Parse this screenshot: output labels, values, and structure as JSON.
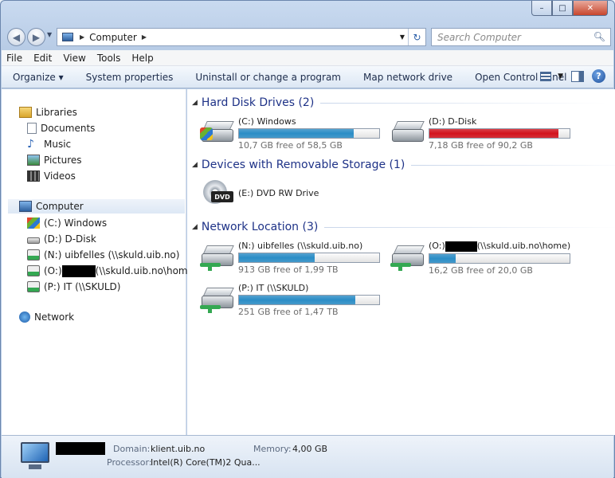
{
  "window": {
    "minimize": "–",
    "maximize": "□",
    "close": "✕"
  },
  "address": {
    "location": "Computer",
    "search_placeholder": "Search Computer"
  },
  "menu": [
    "File",
    "Edit",
    "View",
    "Tools",
    "Help"
  ],
  "toolbar": {
    "organize": "Organize ▾",
    "system_properties": "System properties",
    "uninstall": "Uninstall or change a program",
    "map_drive": "Map network drive",
    "control_panel": "Open Control Panel",
    "help": "?"
  },
  "nav": {
    "libraries": "Libraries",
    "documents": "Documents",
    "music": "Music",
    "pictures": "Pictures",
    "videos": "Videos",
    "computer": "Computer",
    "c_drive": "(C:) Windows",
    "d_drive": "(D:) D-Disk",
    "n_drive": "(N:) uibfelles (\\\\skuld.uib.no)",
    "o_drive_prefix": "(O:)",
    "o_drive_suffix": "(\\\\skuld.uib.no\\home)",
    "p_drive": "(P:) IT (\\\\SKULD)",
    "network": "Network"
  },
  "groups": {
    "hard_disk": "Hard Disk Drives (2)",
    "removable": "Devices with Removable Storage (1)",
    "network": "Network Location (3)"
  },
  "drives": {
    "c": {
      "name": "(C:) Windows",
      "free": "10,7 GB free of 58,5 GB",
      "used_fraction": 0.82,
      "color": "#2b8dc6"
    },
    "d": {
      "name": "(D:) D-Disk",
      "free": "7,18 GB free of 90,2 GB",
      "used_fraction": 0.92,
      "color": "#d2141e"
    },
    "e": {
      "name": "(E:) DVD RW Drive",
      "icon_label": "DVD"
    },
    "n": {
      "name": "(N:) uibfelles (\\\\skuld.uib.no)",
      "free": "913 GB free of 1,99 TB",
      "used_fraction": 0.54,
      "color": "#2b8dc6"
    },
    "o": {
      "name_prefix": "(O:)",
      "name_suffix": "(\\\\skuld.uib.no\\home)",
      "free": "16,2 GB free of 20,0 GB",
      "used_fraction": 0.19,
      "color": "#2b8dc6"
    },
    "p": {
      "name": "(P:) IT (\\\\SKULD)",
      "free": "251 GB free of 1,47 TB",
      "used_fraction": 0.83,
      "color": "#2b8dc6"
    }
  },
  "status": {
    "domain_label": "Domain:",
    "domain": "klient.uib.no",
    "memory_label": "Memory:",
    "memory": "4,00 GB",
    "processor_label": "Processor:",
    "processor": "Intel(R) Core(TM)2 Qua..."
  }
}
